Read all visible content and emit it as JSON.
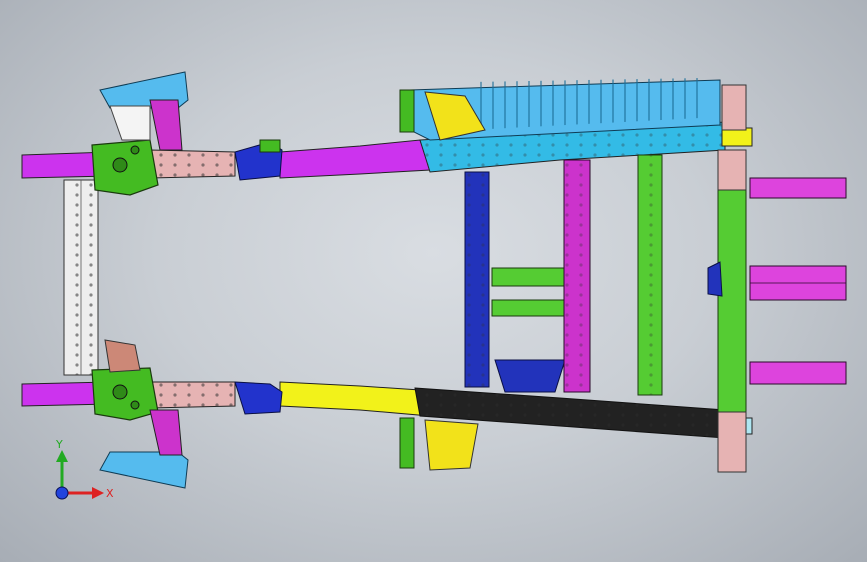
{
  "viewport": {
    "background_top": "#d9dde2",
    "background_edge": "#a7adb5"
  },
  "model": {
    "part_colors": {
      "frame_rail_magenta": "#cc33ee",
      "frame_rail_cyan": "#33bbe6",
      "frame_rail_black": "#222222",
      "frame_rail_yellow": "#f2f21a",
      "front_crossmember_white": "#eeeeee",
      "bracket_green": "#44bb22",
      "bracket_blue": "#2233cc",
      "bracket_pink": "#e6b3b3",
      "crossmember_green": "#55cc33",
      "crossmember_magenta": "#cc33cc",
      "crossmember_blue": "#2233bb",
      "hitch_magenta": "#dd44dd",
      "cab_mount_cyan": "#55bbee"
    }
  },
  "triad": {
    "x_label": "X",
    "y_label": "Y",
    "x_color": "#dd2222",
    "y_color": "#22aa22",
    "z_color": "#2244dd"
  }
}
